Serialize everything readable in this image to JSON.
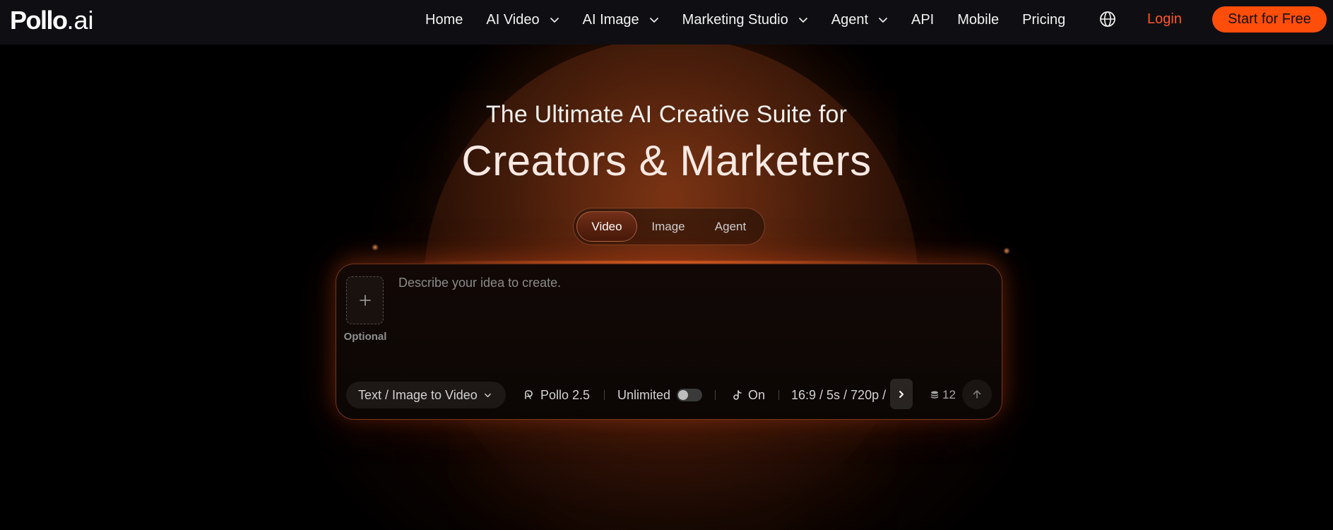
{
  "logo": {
    "brand": "Pollo",
    "suffix": ".ai"
  },
  "nav": {
    "items": [
      {
        "label": "Home",
        "has_menu": false
      },
      {
        "label": "AI Video",
        "has_menu": true
      },
      {
        "label": "AI Image",
        "has_menu": true
      },
      {
        "label": "Marketing Studio",
        "has_menu": true
      },
      {
        "label": "Agent",
        "has_menu": true
      },
      {
        "label": "API",
        "has_menu": false
      },
      {
        "label": "Mobile",
        "has_menu": false
      },
      {
        "label": "Pricing",
        "has_menu": false
      }
    ],
    "globe_icon": "globe-icon",
    "login_label": "Login",
    "cta_label": "Start for Free"
  },
  "hero": {
    "subtitle": "The Ultimate AI Creative Suite for",
    "title": "Creators & Marketers"
  },
  "tabs": [
    {
      "label": "Video",
      "active": true
    },
    {
      "label": "Image",
      "active": false
    },
    {
      "label": "Agent",
      "active": false
    }
  ],
  "prompt": {
    "placeholder": "Describe your idea to create.",
    "upload_label": "Optional",
    "mode_label": "Text / Image to Video",
    "model_label": "Pollo 2.5",
    "unlimited_label": "Unlimited",
    "unlimited_on": false,
    "sound_label": "On",
    "settings_label": "16:9 / 5s / 720p /",
    "credits": "12"
  },
  "colors": {
    "accent": "#ff4d0a",
    "login": "#ff5722",
    "nav_bg": "#0f0f13",
    "background": "#000000"
  }
}
